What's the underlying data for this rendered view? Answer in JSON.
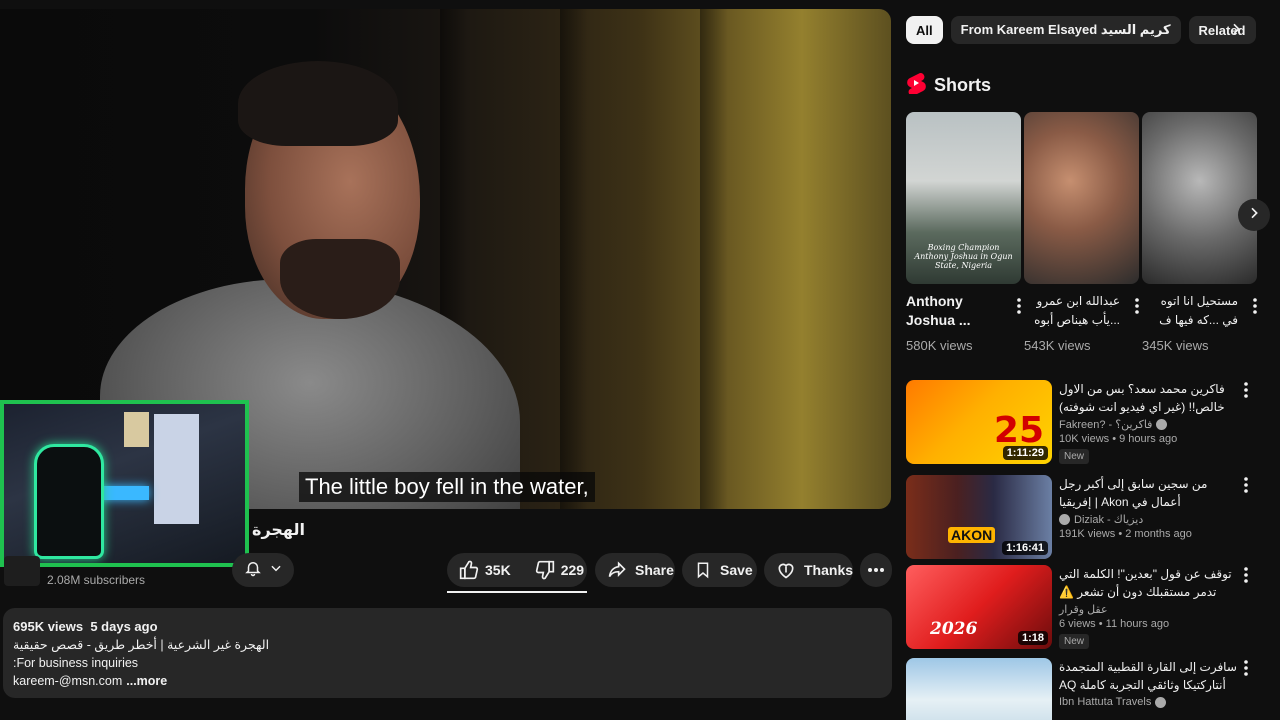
{
  "player": {
    "subtitle": "The little boy fell in the water,"
  },
  "video": {
    "title": "الهجرة",
    "subscribers": "2.08M subscribers",
    "likes": "35K",
    "dislikes": "229",
    "share_label": "Share",
    "save_label": "Save",
    "thanks_label": "Thanks"
  },
  "description": {
    "views": "695K views",
    "age": "5 days ago",
    "line1": "الهجرة غير الشرعية | أخطر طريق - قصص حقيقية",
    "line2": ":For business inquiries",
    "line3": "kareem-@msn.com",
    "more": "...more"
  },
  "chips": {
    "items": [
      "All",
      "From Kareem Elsayed كريم السيد",
      "Related"
    ],
    "active": "All"
  },
  "shorts": {
    "heading": "Shorts",
    "items": [
      {
        "title": "Anthony Joshua ...",
        "views": "580K views",
        "caption": "Boxing Champion Anthony Joshua in Ogun State, Nigeria",
        "color": "#b9c1c3"
      },
      {
        "title": "عبدالله ابن عمرو ...يأب هيناص أبوه",
        "views": "543K views",
        "caption": "",
        "color": "#8a5b46"
      },
      {
        "title": "مستحيل انا اتوه في ...كه فيها ف الاخر",
        "views": "345K views",
        "caption": "",
        "color": "#6a6a6a"
      }
    ]
  },
  "videos": [
    {
      "title": "فاكرين محمد سعد؟ بس من الاول خالص!! (غير اي فيديو انت شوفته)",
      "channel": "Fakreen? - فاكرين؟",
      "views": "10K views",
      "age": "9 hours ago",
      "badge": "New",
      "duration": "1:11:29",
      "thumb_text": "25"
    },
    {
      "title": "من سجين سابق إلى أكبر رجل أعمال في Akon | إفريقيا",
      "channel": "Diziak - ديزياك",
      "views": "191K views",
      "age": "2 months ago",
      "badge": "",
      "duration": "1:16:41",
      "thumb_text": "AKON"
    },
    {
      "title": "توقف عن قول \"بعدين\"! الكلمة التي تدمر مستقبلك دون أن تشعر ⚠️",
      "channel": "عقل وقرار",
      "views": "6 views",
      "age": "11 hours ago",
      "badge": "New",
      "duration": "1:18",
      "thumb_text": "2026"
    },
    {
      "title": "سافرت إلى القارة القطبية المتجمدة أنتاركتيكا وثائقي التجربة كاملة AQ",
      "channel": "Ibn Hattuta Travels",
      "views": "",
      "age": "",
      "badge": "",
      "duration": "",
      "thumb_text": ""
    }
  ],
  "colors": {
    "background": "#0f0f0f",
    "surface": "#272727",
    "webcam_border": "#1fc14f",
    "shorts_red": "#ff0033"
  }
}
